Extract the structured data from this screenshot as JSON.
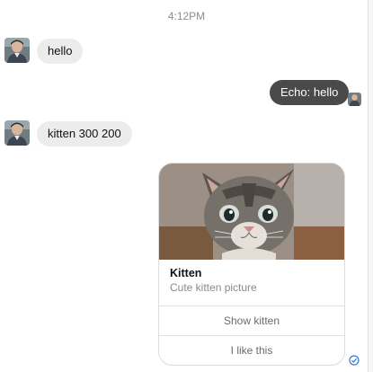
{
  "conversation": {
    "timestamp": "4:12PM",
    "messages": [
      {
        "direction": "incoming",
        "text": "hello"
      },
      {
        "direction": "outgoing",
        "text": "Echo: hello"
      },
      {
        "direction": "incoming",
        "text": "kitten 300 200"
      }
    ],
    "card": {
      "image_icon": "kitten-photo",
      "title": "Kitten",
      "subtitle": "Cute kitten picture",
      "buttons": [
        "Show kitten",
        "I like this"
      ]
    },
    "status_icon": "delivered-check-icon"
  },
  "colors": {
    "incoming_bubble": "#ececec",
    "outgoing_bubble": "#4a4a4a",
    "timestamp_text": "#8d8d8d"
  }
}
